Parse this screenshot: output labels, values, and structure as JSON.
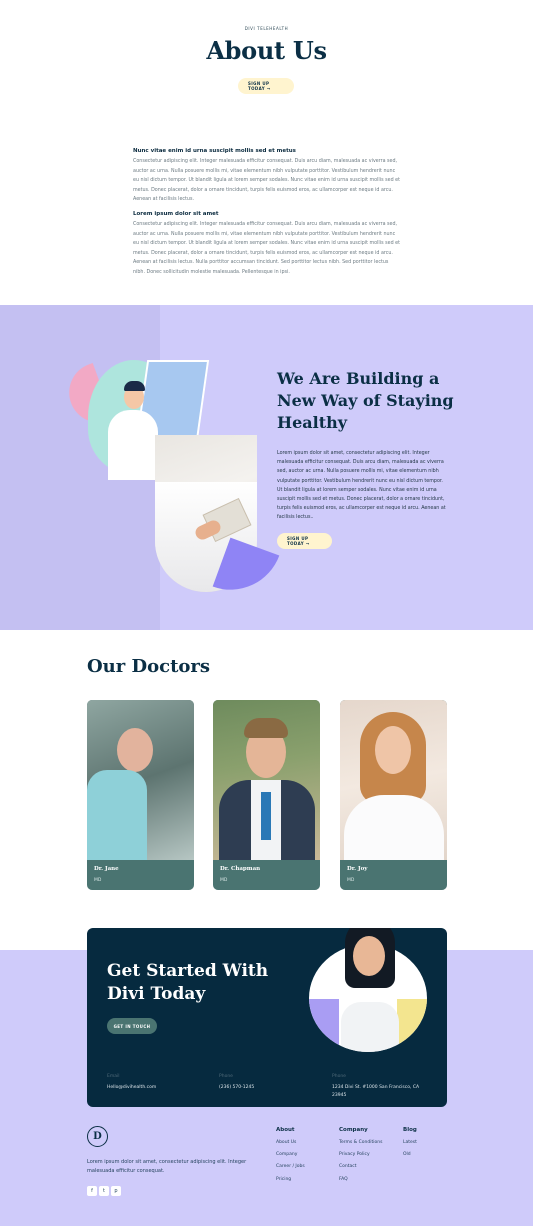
{
  "hero": {
    "eyebrow": "DIVI TELEHEALTH",
    "title": "About Us",
    "cta": "SIGN UP TODAY →"
  },
  "intro": {
    "h1": "Nunc vitae enim id urna suscipit mollis sed et metus",
    "p1": "Consectetur adipiscing elit. Integer malesuada efficitur consequat. Duis arcu diam, malesuada ac viverra sed, auctor ac urna. Nulla posuere mollis mi, vitae elementum nibh vulputate porttitor. Vestibulum hendrerit nunc eu nisl dictum tempor. Ut blandit ligula at lorem semper sodales. Nunc vitae enim id urna suscipit mollis sed et metus. Donec placerat, dolor a ornare tincidunt, turpis felis euismod eros, ac ullamcorper est neque id arcu. Aenean at facilisis lectus.",
    "h2": "Lorem ipsum dolor sit amet",
    "p2": "Consectetur adipiscing elit. Integer malesuada efficitur consequat. Duis arcu diam, malesuada ac viverra sed, auctor ac urna. Nulla posuere mollis mi, vitae elementum nibh vulputate porttitor. Vestibulum hendrerit nunc eu nisl dictum tempor. Ut blandit ligula at lorem semper sodales. Nunc vitae enim id urna suscipit mollis sed et metus. Donec placerat, dolor a ornare tincidunt, turpis felis euismod eros, ac ullamcorper est neque id arcu. Aenean at facilisis lectus. Nulla porttitor accumsan tincidunt. Sed porttitor lectus nibh. Sed porttitor lectus nibh. Donec sollicitudin molestie malesuada. Pellentesque in ipsi."
  },
  "building": {
    "title": "We Are Building a New Way of Staying Healthy",
    "body": "Lorem ipsum dolor sit amet, consectetur adipiscing elit. Integer malesuada efficitur consequat. Duis arcu diam, malesuada ac viverra sed, auctor ac urna. Nulla posuere mollis mi, vitae elementum nibh vulputate porttitor. Vestibulum hendrerit nunc eu nisl dictum tempor. Ut blandit ligula at lorem semper sodales. Nunc vitae enim id urna suscipit mollis sed et metus. Donec placerat, dolor a ornare tincidunt, turpis felis euismod eros, ac ullamcorper est neque id arcu. Aenean at facilisis lectus..",
    "cta": "SIGN UP TODAY →"
  },
  "doctors": {
    "title": "Our Doctors",
    "list": [
      {
        "name": "Dr. Jane",
        "role": "MD"
      },
      {
        "name": "Dr. Chapman",
        "role": "MD"
      },
      {
        "name": "Dr. Joy",
        "role": "MD"
      }
    ]
  },
  "cta": {
    "title": "Get Started With Divi Today",
    "button": "GET IN TOUCH",
    "email_label": "Email",
    "email": "Hello@divihealth.com",
    "phone_label": "Phone",
    "phone": "(236) 570-1245",
    "address_label": "Phone",
    "address": "1234 Divi St. #1000 San Francisco, CA 23945"
  },
  "footer": {
    "logo": "D",
    "text": "Lorem ipsum dolor sit amet, consectetur adipiscing elit. Integer malesuada efficitur consequat.",
    "socials": [
      "f",
      "t",
      "p"
    ],
    "cols": [
      {
        "title": "About",
        "links": [
          "About Us",
          "Company",
          "Career / Jobs",
          "Pricing"
        ]
      },
      {
        "title": "Company",
        "links": [
          "Terms & Conditions",
          "Privacy Policy",
          "Contact",
          "FAQ"
        ]
      },
      {
        "title": "Blog",
        "links": [
          "Latest",
          "Old"
        ]
      }
    ]
  },
  "colors": {
    "navy": "#0b2f45",
    "lavender": "#cfcbfa",
    "teal": "#4a7471",
    "cream": "#fff4cf"
  }
}
